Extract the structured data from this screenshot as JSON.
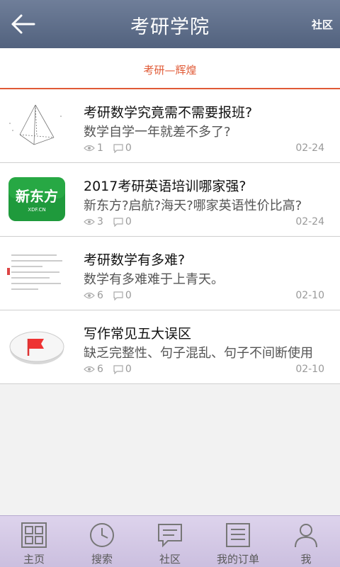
{
  "header": {
    "title": "考研学院",
    "right_link": "社区",
    "back_icon": "back-arrow-icon"
  },
  "subheader": {
    "title": "考研—辉煌",
    "accent_color": "#e05a36"
  },
  "posts": [
    {
      "title": "考研数学究竟需不需要报班?",
      "summary": "数学自学一年就差不多了?",
      "views": "1",
      "comments": "0",
      "date": "02-24",
      "thumb": "geometry-sketch"
    },
    {
      "title": "2017考研英语培训哪家强?",
      "summary": "新东方?启航?海天?哪家英语性价比高?",
      "views": "3",
      "comments": "0",
      "date": "02-24",
      "thumb": "xdf-logo",
      "thumb_text": "新东方",
      "thumb_subtext": "XDF.CN"
    },
    {
      "title": "考研数学有多难?",
      "summary": "数学有多难难于上青天。",
      "views": "6",
      "comments": "0",
      "date": "02-10",
      "thumb": "document-scan"
    },
    {
      "title": "写作常见五大误区",
      "summary": "缺乏完整性、句子混乱、句子不间断使用",
      "views": "6",
      "comments": "0",
      "date": "02-10",
      "thumb": "red-flag"
    }
  ],
  "tabs": [
    {
      "label": "主页",
      "icon": "grid-icon",
      "active": true
    },
    {
      "label": "搜索",
      "icon": "clock-icon"
    },
    {
      "label": "社区",
      "icon": "chat-icon"
    },
    {
      "label": "我的订单",
      "icon": "list-icon"
    },
    {
      "label": "我",
      "icon": "user-icon"
    }
  ]
}
